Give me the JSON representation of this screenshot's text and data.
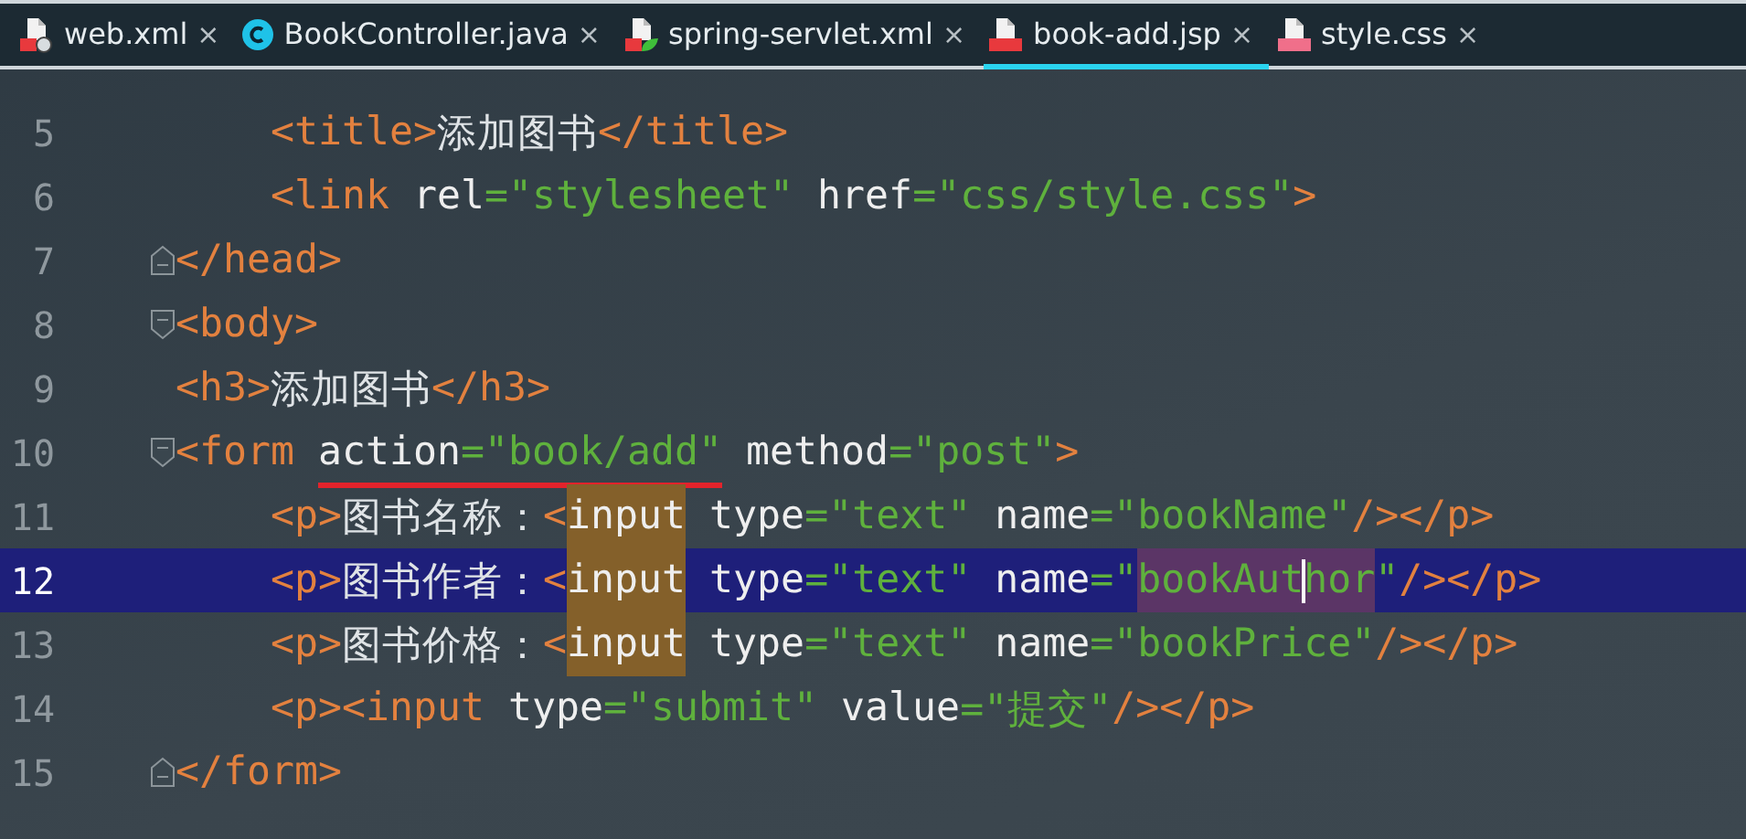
{
  "tabs": [
    {
      "label": "web.xml",
      "kind": "xml",
      "close": "×",
      "selected": false
    },
    {
      "label": "BookController.java",
      "kind": "class",
      "close": "×",
      "selected": false
    },
    {
      "label": "spring-servlet.xml",
      "kind": "spring-xml",
      "close": "×",
      "selected": false
    },
    {
      "label": "book-add.jsp",
      "kind": "jsp",
      "close": "×",
      "selected": true
    },
    {
      "label": "style.css",
      "kind": "css",
      "close": "×",
      "selected": false
    }
  ],
  "lines": [
    {
      "number": "5",
      "current": false,
      "kind": "plain",
      "tokens": [
        {
          "kind": "tag",
          "text": "    <title>"
        },
        {
          "kind": "text",
          "text": "添加图书"
        },
        {
          "kind": "tag",
          "text": "</title>"
        }
      ]
    },
    {
      "number": "6",
      "current": false,
      "kind": "plain",
      "tokens": [
        {
          "kind": "tag",
          "text": "    <link "
        },
        {
          "kind": "attr",
          "text": "rel"
        },
        {
          "kind": "string",
          "text": "=\"stylesheet\" "
        },
        {
          "kind": "attr",
          "text": "href"
        },
        {
          "kind": "string",
          "text": "=\"css/style.css\""
        },
        {
          "kind": "tag",
          "text": ">"
        }
      ]
    },
    {
      "number": "7",
      "current": false,
      "kind": "fold-end",
      "tokens": [
        {
          "kind": "tag",
          "text": "</head>"
        }
      ]
    },
    {
      "number": "8",
      "current": false,
      "kind": "fold-start",
      "tokens": [
        {
          "kind": "tag",
          "text": "<body>"
        }
      ]
    },
    {
      "number": "9",
      "current": false,
      "kind": "plain",
      "tokens": [
        {
          "kind": "tag",
          "text": "<h3>"
        },
        {
          "kind": "text",
          "text": "添加图书"
        },
        {
          "kind": "tag",
          "text": "</h3>"
        }
      ]
    },
    {
      "number": "10",
      "current": false,
      "kind": "fold-start",
      "tokens": [
        {
          "kind": "tag",
          "text": "<form "
        },
        {
          "kind": "attr",
          "text": "action",
          "underline": true
        },
        {
          "kind": "string",
          "text": "=\"book/add\"",
          "underline": true
        },
        {
          "kind": "attr",
          "text": " method"
        },
        {
          "kind": "string",
          "text": "=\"post\""
        },
        {
          "kind": "tag",
          "text": ">"
        }
      ]
    },
    {
      "number": "11",
      "current": false,
      "kind": "plain",
      "tokens": [
        {
          "kind": "tag",
          "text": "    <p>"
        },
        {
          "kind": "text",
          "text": "图书名称："
        },
        {
          "kind": "tag",
          "text": "<"
        },
        {
          "kind": "attr",
          "text": "input",
          "usage_highlight": true
        },
        {
          "kind": "attr",
          "text": " type"
        },
        {
          "kind": "string",
          "text": "=\"text\" "
        },
        {
          "kind": "attr",
          "text": "name"
        },
        {
          "kind": "string",
          "text": "=\"bookName\""
        },
        {
          "kind": "tag",
          "text": "/></p>"
        }
      ]
    },
    {
      "number": "12",
      "current": true,
      "kind": "plain",
      "tokens": [
        {
          "kind": "tag",
          "text": "    <p>"
        },
        {
          "kind": "text",
          "text": "图书作者："
        },
        {
          "kind": "tag",
          "text": "<"
        },
        {
          "kind": "attr",
          "text": "input",
          "usage_highlight": true
        },
        {
          "kind": "attr",
          "text": " type"
        },
        {
          "kind": "string",
          "text": "=\"text\" "
        },
        {
          "kind": "attr",
          "text": "name"
        },
        {
          "kind": "string",
          "text": "=\""
        },
        {
          "kind": "string",
          "text": "bookAut",
          "search_highlight": true
        },
        {
          "kind": "caret"
        },
        {
          "kind": "string",
          "text": "hor",
          "search_highlight": true
        },
        {
          "kind": "string",
          "text": "\""
        },
        {
          "kind": "tag",
          "text": "/></p>"
        }
      ]
    },
    {
      "number": "13",
      "current": false,
      "kind": "plain",
      "tokens": [
        {
          "kind": "tag",
          "text": "    <p>"
        },
        {
          "kind": "text",
          "text": "图书价格："
        },
        {
          "kind": "tag",
          "text": "<"
        },
        {
          "kind": "attr",
          "text": "input",
          "usage_highlight": true
        },
        {
          "kind": "attr",
          "text": " type"
        },
        {
          "kind": "string",
          "text": "=\"text\" "
        },
        {
          "kind": "attr",
          "text": "name"
        },
        {
          "kind": "string",
          "text": "=\"bookPrice\""
        },
        {
          "kind": "tag",
          "text": "/></p>"
        }
      ]
    },
    {
      "number": "14",
      "current": false,
      "kind": "plain",
      "tokens": [
        {
          "kind": "tag",
          "text": "    <p><input "
        },
        {
          "kind": "attr",
          "text": "type"
        },
        {
          "kind": "string",
          "text": "=\"submit\" "
        },
        {
          "kind": "attr",
          "text": "value"
        },
        {
          "kind": "string",
          "text": "=\"提交\""
        },
        {
          "kind": "tag",
          "text": "/></p>"
        }
      ]
    },
    {
      "number": "15",
      "current": false,
      "kind": "fold-end",
      "tokens": [
        {
          "kind": "tag",
          "text": "</form>"
        }
      ]
    }
  ]
}
